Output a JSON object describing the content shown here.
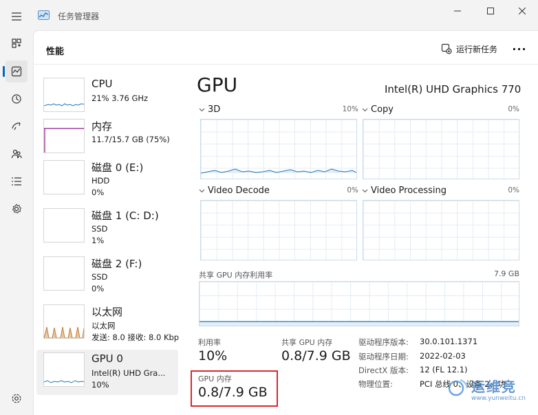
{
  "app": {
    "title": "任务管理器"
  },
  "rail": [
    "menu-icon",
    "processes-icon",
    "performance-icon",
    "app-history-icon",
    "startup-icon",
    "users-icon",
    "details-icon",
    "services-icon",
    "settings-icon"
  ],
  "header": {
    "page_title": "性能",
    "run_task": "运行新任务",
    "more": "···"
  },
  "list": [
    {
      "name": "CPU",
      "line2": "21% 3.76 GHz",
      "line3": ""
    },
    {
      "name": "内存",
      "line2": "11.7/15.7 GB (75%)",
      "line3": ""
    },
    {
      "name": "磁盘 0 (E:)",
      "line2": "HDD",
      "line3": "0%"
    },
    {
      "name": "磁盘 1 (C: D:)",
      "line2": "SSD",
      "line3": "1%"
    },
    {
      "name": "磁盘 2 (F:)",
      "line2": "SSD",
      "line3": "0%"
    },
    {
      "name": "以太网",
      "line2": "以太网",
      "line3": "发送: 8.0 接收: 8.0 Kbp"
    },
    {
      "name": "GPU 0",
      "line2": "Intel(R) UHD Gra...",
      "line3": "10%"
    }
  ],
  "detail": {
    "title": "GPU",
    "model": "Intel(R) UHD Graphics 770",
    "graphs": [
      {
        "label": "3D",
        "value": "10%"
      },
      {
        "label": "Copy",
        "value": "0%"
      },
      {
        "label": "Video Decode",
        "value": "0%"
      },
      {
        "label": "Video Processing",
        "value": "0%"
      }
    ],
    "shared_label": "共享 GPU 内存利用率",
    "shared_max": "7.9 GB",
    "stats": {
      "util_label": "利用率",
      "util_value": "10%",
      "shared_label": "共享 GPU 内存",
      "shared_value": "0.8/7.9 GB",
      "gpu_mem_label": "GPU 内存",
      "gpu_mem_value": "0.8/7.9 GB"
    },
    "info": [
      {
        "label": "驱动程序版本:",
        "value": "30.0.101.1371"
      },
      {
        "label": "驱动程序日期:",
        "value": "2022-02-03"
      },
      {
        "label": "DirectX 版本:",
        "value": "12 (FL 12.1)"
      },
      {
        "label": "物理位置:",
        "value": "PCI 总线 0、设备 2、功..."
      }
    ]
  },
  "watermark": {
    "text": "运维竞",
    "url": "www.yunweitu.cn"
  },
  "colors": {
    "accent": "#0067c0",
    "graph_line": "#1f77b4",
    "highlight": "#d9272e",
    "memory": "#8b1a89",
    "network": "#c2782a"
  }
}
